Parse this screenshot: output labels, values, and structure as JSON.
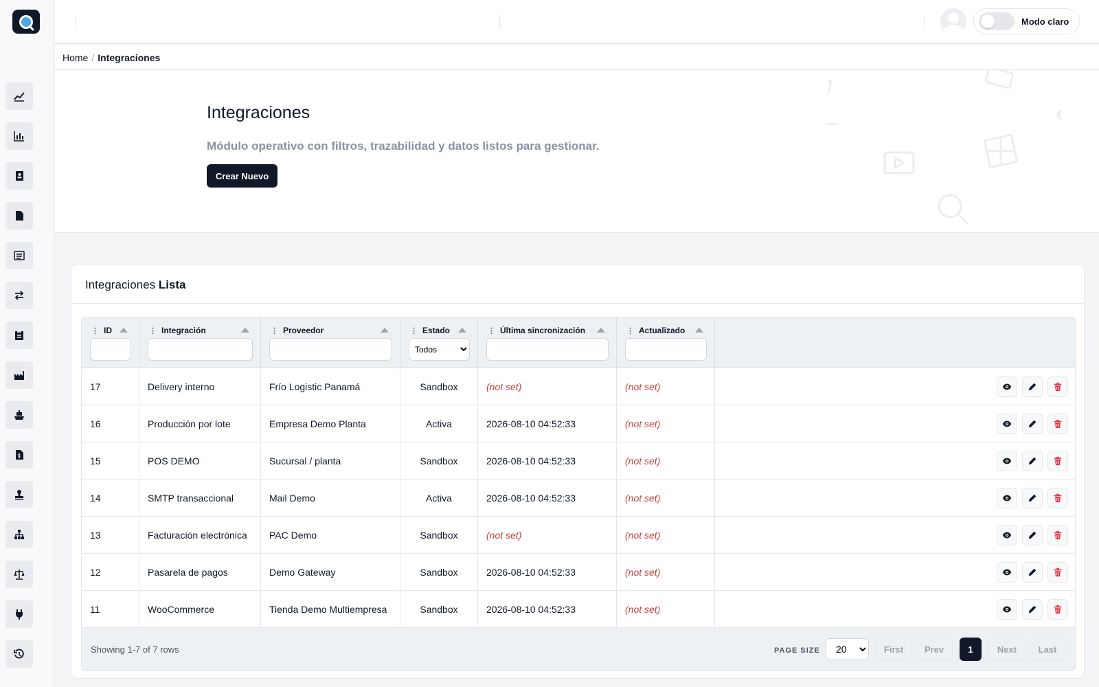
{
  "topbar": {
    "theme_label": "Modo claro"
  },
  "sidebar": {
    "items": [
      {
        "icon": "line-chart-icon"
      },
      {
        "icon": "bar-chart-icon"
      },
      {
        "icon": "contact-book-icon"
      },
      {
        "icon": "file-icon"
      },
      {
        "icon": "list-icon"
      },
      {
        "icon": "exchange-icon"
      },
      {
        "icon": "clipboard-icon"
      },
      {
        "icon": "industry-icon"
      },
      {
        "icon": "ship-icon"
      },
      {
        "icon": "invoice-icon"
      },
      {
        "icon": "stamp-icon"
      },
      {
        "icon": "sitemap-icon"
      },
      {
        "icon": "scale-icon"
      },
      {
        "icon": "plug-icon"
      },
      {
        "icon": "history-icon"
      }
    ]
  },
  "breadcrumb": {
    "home": "Home",
    "separator": "/",
    "current": "Integraciones"
  },
  "hero": {
    "title": "Integraciones",
    "subtitle": "Módulo operativo con filtros, trazabilidad y datos listos para gestionar.",
    "create_button": "Crear Nuevo"
  },
  "list": {
    "title_prefix": "Integraciones",
    "title_bold": "Lista",
    "columns": [
      "ID",
      "Integración",
      "Proveedor",
      "Estado",
      "Última sincronización",
      "Actualizado"
    ],
    "estado_filter_value": "Todos",
    "rows": [
      {
        "id": "17",
        "integracion": "Delivery interno",
        "proveedor": "Frío Logistic Panamá",
        "estado": "Sandbox",
        "sync": "(not set)",
        "actualizado": "(not set)"
      },
      {
        "id": "16",
        "integracion": "Producción por lote",
        "proveedor": "Empresa Demo Planta",
        "estado": "Activa",
        "sync": "2026-08-10 04:52:33",
        "actualizado": "(not set)"
      },
      {
        "id": "15",
        "integracion": "POS DEMO",
        "proveedor": "Sucursal / planta",
        "estado": "Sandbox",
        "sync": "2026-08-10 04:52:33",
        "actualizado": "(not set)"
      },
      {
        "id": "14",
        "integracion": "SMTP transaccional",
        "proveedor": "Mail Demo",
        "estado": "Activa",
        "sync": "2026-08-10 04:52:33",
        "actualizado": "(not set)"
      },
      {
        "id": "13",
        "integracion": "Facturación electrónica",
        "proveedor": "PAC Demo",
        "estado": "Sandbox",
        "sync": "(not set)",
        "actualizado": "(not set)"
      },
      {
        "id": "12",
        "integracion": "Pasarela de pagos",
        "proveedor": "Demo Gateway",
        "estado": "Sandbox",
        "sync": "2026-08-10 04:52:33",
        "actualizado": "(not set)"
      },
      {
        "id": "11",
        "integracion": "WooCommerce",
        "proveedor": "Tienda Demo Multiempresa",
        "estado": "Sandbox",
        "sync": "2026-08-10 04:52:33",
        "actualizado": "(not set)"
      }
    ]
  },
  "pagination": {
    "showing": "Showing 1-7 of 7 rows",
    "page_size_label": "PAGE SIZE",
    "page_size_value": "20",
    "first": "First",
    "prev": "Prev",
    "current_page": "1",
    "next": "Next",
    "last": "Last"
  },
  "colors": {
    "brand_dark": "#111827",
    "not_set": "#c2413b",
    "delete": "#dc3545"
  }
}
